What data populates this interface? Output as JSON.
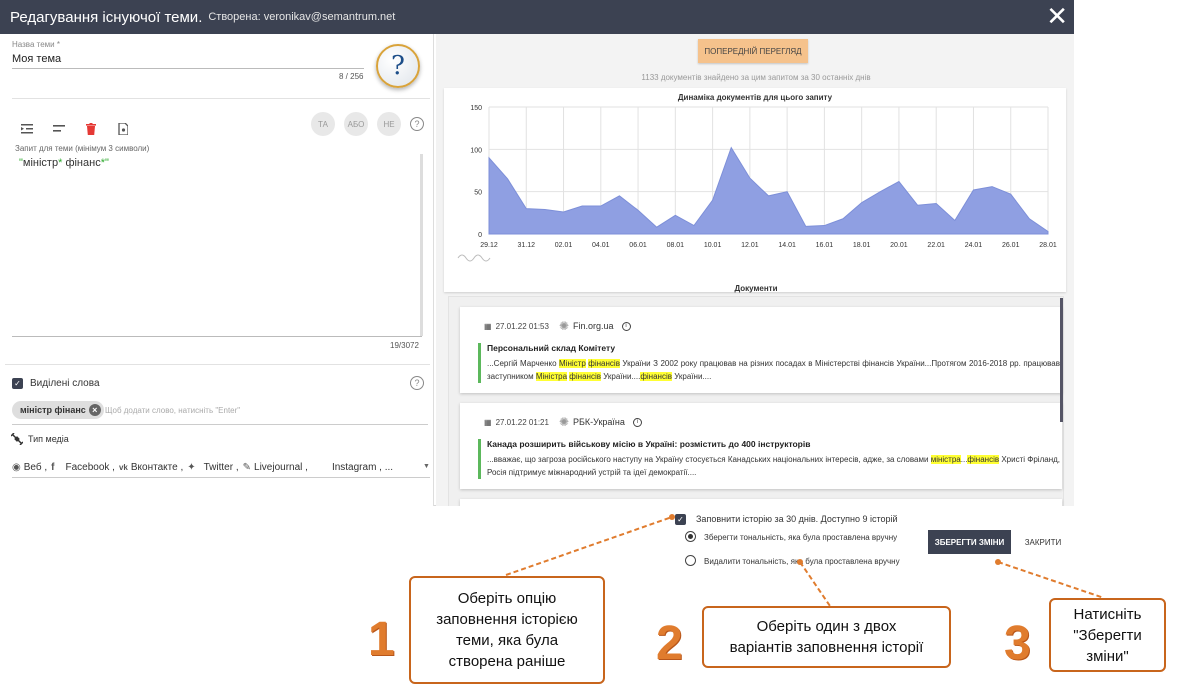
{
  "header": {
    "title": "Редагування існуючої теми.",
    "creator": "Створена: veronikav@semantrum.net",
    "close_glyph": "✕"
  },
  "left": {
    "name_label": "Назва теми *",
    "name_value": "Моя тема",
    "name_counter": "8 / 256",
    "help_glyph": "?",
    "ops": [
      "ТА",
      "АБО",
      "НЕ"
    ],
    "help_q": "?",
    "query_label": "Запит для теми (мінімум 3 символи)",
    "query_parts": {
      "q1": "\"",
      "t1": "міністр",
      "q2": "* ",
      "t2": "фінанс",
      "q3": "*\""
    },
    "query_counter": "19/3072",
    "highlight_label": "Виділені слова",
    "chip": "міністр фінанс",
    "chip_hint": "Щоб додати слово, натисніть \"Enter\"",
    "media_label": "Тип медіа",
    "sources": [
      "Веб ,",
      "Facebook ,",
      "Вконтакте ,",
      "Twitter ,",
      "Livejournal ,",
      "Instagram , ..."
    ]
  },
  "right": {
    "preview_button": "ПОПЕРЕДНІЙ ПЕРЕГЛЯД",
    "found_text": "1133 документів знайдено за цим запитом за 30 останніх днів",
    "docs_title": "Документи",
    "docs": [
      {
        "datetime": "27.01.22 01:53",
        "source": "Fin.org.ua",
        "title": "Персональний склад Комітету",
        "text": [
          {
            "t": "...Сергій Марченко "
          },
          {
            "h": "Міністр"
          },
          {
            "t": " "
          },
          {
            "h": "фінансів"
          },
          {
            "t": " України З 2002 року працював на різних посадах в Міністерстві фінансів України...Протягом 2016-2018 рр. працював заступником "
          },
          {
            "h": "Міністра"
          },
          {
            "t": " "
          },
          {
            "h": "фінансів"
          },
          {
            "t": " України...."
          },
          {
            "h": "фінансів"
          },
          {
            "t": " України...."
          }
        ]
      },
      {
        "datetime": "27.01.22 01:21",
        "source": "РБК-Україна",
        "title": "Канада розширить військову місію в Україні: розмістить до 400 інструкторів",
        "text": [
          {
            "t": "...вважає, що загроза російського наступу на Україну стосується Канадських національних інтересів, адже, за словами "
          },
          {
            "h": "міністра"
          },
          {
            "t": "..."
          },
          {
            "h": "фінансів"
          },
          {
            "t": " Христі Фріланд, Росія підтримує міжнародний устрій та ідеї демократії...."
          }
        ]
      }
    ]
  },
  "chart_data": {
    "type": "area",
    "title": "Динаміка документів для цього запиту",
    "xlabel": "",
    "ylabel": "",
    "ylim": [
      0,
      150
    ],
    "yticks": [
      0,
      50,
      100,
      150
    ],
    "xticks": [
      "29.12",
      "31.12",
      "02.01",
      "04.01",
      "06.01",
      "08.01",
      "10.01",
      "12.01",
      "14.01",
      "16.01",
      "18.01",
      "20.01",
      "22.01",
      "24.01",
      "26.01",
      "28.01"
    ],
    "x": [
      "29.12",
      "30.12",
      "31.12",
      "01.01",
      "02.01",
      "03.01",
      "04.01",
      "05.01",
      "06.01",
      "07.01",
      "08.01",
      "09.01",
      "10.01",
      "11.01",
      "12.01",
      "13.01",
      "14.01",
      "15.01",
      "16.01",
      "17.01",
      "18.01",
      "19.01",
      "20.01",
      "21.01",
      "22.01",
      "23.01",
      "24.01",
      "25.01",
      "26.01",
      "27.01",
      "28.01"
    ],
    "values": [
      90,
      65,
      30,
      29,
      26,
      33,
      33,
      45,
      28,
      8,
      22,
      10,
      40,
      102,
      66,
      45,
      50,
      9,
      10,
      18,
      37,
      50,
      62,
      34,
      36,
      16,
      52,
      56,
      47,
      18,
      3
    ],
    "series_color": "#8f9fe2",
    "grid": true
  },
  "bottom": {
    "fill_label": "Заповнити історію за 30 днів. Доступно 9 історій",
    "radio1": "Зберегти тональність, яка була проставлена вручну",
    "radio2": "Видалити тональність, яка була проставлена вручну",
    "save_button": "ЗБЕРЕГТИ ЗМІНИ",
    "close_button": "ЗАКРИТИ"
  },
  "annotations": {
    "n1": "1",
    "n2": "2",
    "n3": "3",
    "c1": [
      "Оберіть опцію",
      "заповнення історією",
      "теми, яка була",
      "створена раніше"
    ],
    "c2": [
      "Оберіть один з двох",
      "варіантів заповнення історії"
    ],
    "c3": [
      "Натисніть",
      "\"Зберегти",
      "зміни\""
    ],
    "accent_color": "#e07c2e"
  }
}
